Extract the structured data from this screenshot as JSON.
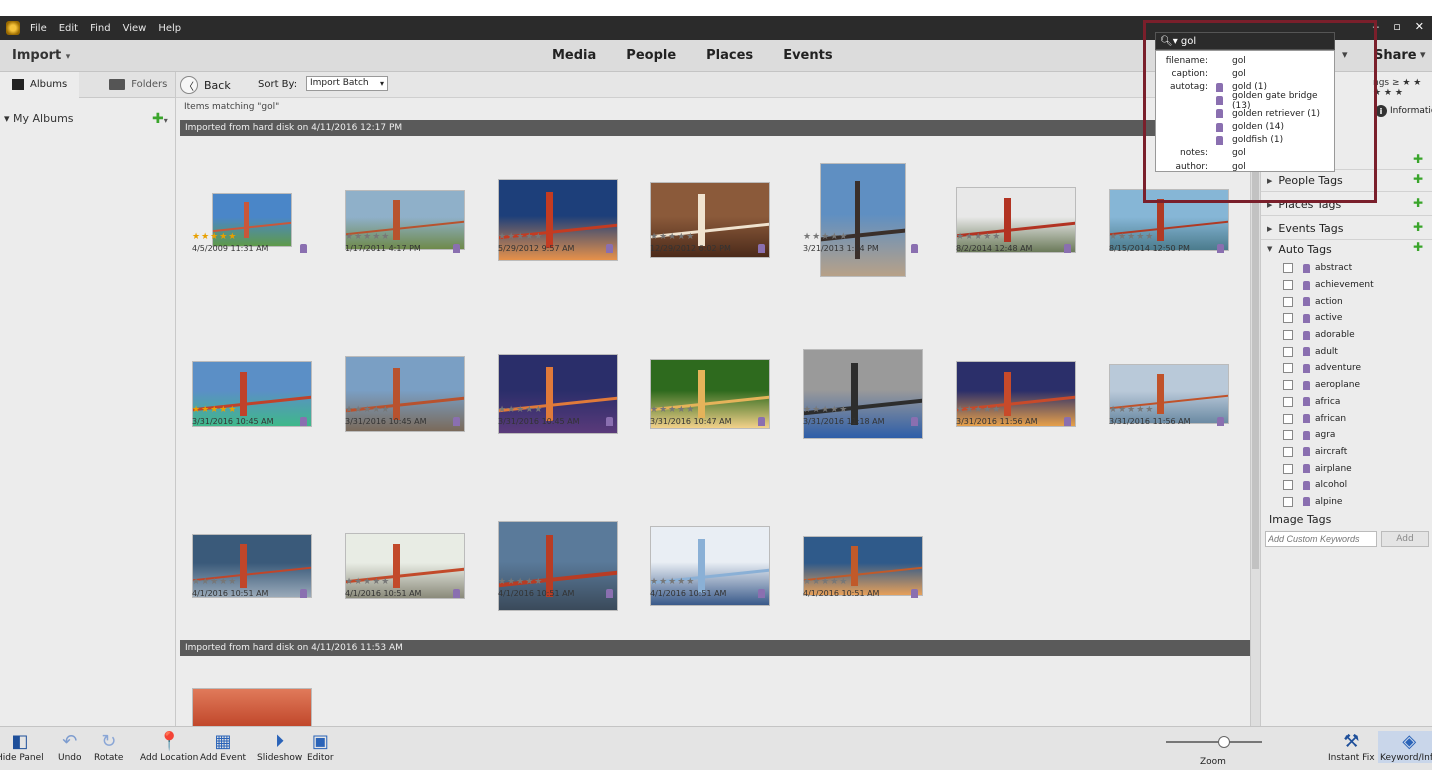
{
  "menu": [
    "File",
    "Edit",
    "Find",
    "View",
    "Help"
  ],
  "toolbar": {
    "import": "Import",
    "tabs": [
      "Media",
      "People",
      "Places",
      "Events"
    ],
    "share": "Share"
  },
  "left_panel": {
    "tab_albums": "Albums",
    "tab_folders": "Folders",
    "my_albums": "My Albums"
  },
  "subbar": {
    "back": "Back",
    "sort_by": "Sort By:",
    "sort_value": "Import Batch"
  },
  "matching": "Items matching \"gol\"",
  "batches": [
    "Imported from hard disk on 4/11/2016 12:17 PM",
    "Imported from hard disk on 4/11/2016 11:53 AM"
  ],
  "photos": [
    {
      "date": "4/5/2009 11:31 AM",
      "rated": true
    },
    {
      "date": "1/17/2011 4:17 PM",
      "rated": false
    },
    {
      "date": "5/29/2012 9:57 AM",
      "rated": false
    },
    {
      "date": "12/29/2012 6:02 PM",
      "rated": false
    },
    {
      "date": "3/21/2013 1:34 PM",
      "rated": false
    },
    {
      "date": "8/2/2014 12:48 AM",
      "rated": false
    },
    {
      "date": "8/15/2014 12:50 PM",
      "rated": false
    },
    {
      "date": "3/31/2016 10:45 AM",
      "rated": true
    },
    {
      "date": "3/31/2016 10:45 AM",
      "rated": false
    },
    {
      "date": "3/31/2016 10:45 AM",
      "rated": false
    },
    {
      "date": "3/31/2016 10:47 AM",
      "rated": false
    },
    {
      "date": "3/31/2016 11:18 AM",
      "rated": false
    },
    {
      "date": "3/31/2016 11:56 AM",
      "rated": false
    },
    {
      "date": "3/31/2016 11:56 AM",
      "rated": false
    },
    {
      "date": "4/1/2016 10:51 AM",
      "rated": false
    },
    {
      "date": "4/1/2016 10:51 AM",
      "rated": false
    },
    {
      "date": "4/1/2016 10:51 AM",
      "rated": false
    },
    {
      "date": "4/1/2016 10:51 AM",
      "rated": false
    },
    {
      "date": "4/1/2016 10:51 AM",
      "rated": false
    }
  ],
  "stars": "★★★★★",
  "right_panel": {
    "ratings": "ngs ≥ ★ ★ ★ ★ ★",
    "information": "Information",
    "sections": [
      "People Tags",
      "Places Tags",
      "Events Tags",
      "Auto Tags"
    ],
    "auto_tags": [
      "abstract",
      "achievement",
      "action",
      "active",
      "adorable",
      "adult",
      "adventure",
      "aeroplane",
      "africa",
      "african",
      "agra",
      "aircraft",
      "airplane",
      "alcohol",
      "alpine"
    ],
    "image_tags": "Image Tags",
    "keyword_placeholder": "Add Custom Keywords",
    "add": "Add"
  },
  "search": {
    "query": "gol",
    "rows": [
      {
        "key": "filename:",
        "value": "gol"
      },
      {
        "key": "caption:",
        "value": "gol"
      },
      {
        "key": "autotag:",
        "value": "gold (1)"
      },
      {
        "key": "",
        "value": "golden gate bridge (13)"
      },
      {
        "key": "",
        "value": "golden retriever (1)"
      },
      {
        "key": "",
        "value": "golden (14)"
      },
      {
        "key": "",
        "value": "goldfish (1)"
      },
      {
        "key": "notes:",
        "value": "gol"
      },
      {
        "key": "author:",
        "value": "gol"
      }
    ]
  },
  "bottom": {
    "items": [
      "Hide Panel",
      "Undo",
      "Rotate",
      "Add Location",
      "Add Event",
      "Slideshow",
      "Editor"
    ],
    "zoom": "Zoom",
    "instant_fix": "Instant Fix",
    "keyword_info": "Keyword/Info"
  },
  "colors": {
    "accent": "#7a1f2b",
    "tag": "#8a6fb0",
    "plus": "#3aa52b",
    "star_gold": "#e8a000"
  }
}
